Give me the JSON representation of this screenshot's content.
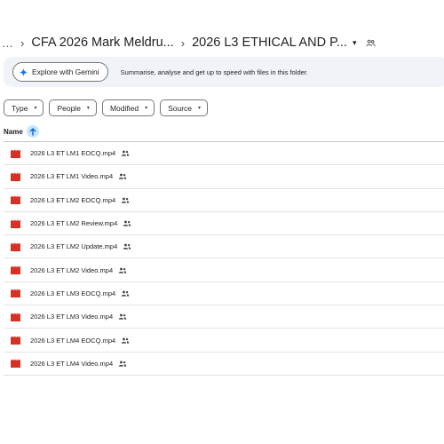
{
  "breadcrumb": {
    "more": "…",
    "separator": "›",
    "parent": "CFA 2026 Mark Meldru...",
    "current": "2026 L3 ETHICAL AND P...",
    "caret": "▾"
  },
  "gemini": {
    "button_label": "Explore with Gemini",
    "hint": "Summarise, analyse and get up to speed with files in this folder."
  },
  "filters": [
    {
      "label": "Type",
      "caret": "▾"
    },
    {
      "label": "People",
      "caret": "▾"
    },
    {
      "label": "Modified",
      "caret": "▾"
    },
    {
      "label": "Source",
      "caret": "▾"
    }
  ],
  "list_header": {
    "name_label": "Name",
    "sort_icon": "arrow-up-icon"
  },
  "files": [
    {
      "name": "2026 L3 ET LM1 EOCQ.mp4"
    },
    {
      "name": "2026 L3 ET LM1 Video.mp4"
    },
    {
      "name": "2026 L3 ET LM2 EOCQ.mp4"
    },
    {
      "name": "2026 L3 ET LM2 Review.mp4"
    },
    {
      "name": "2026 L3 ET LM2 Update.mp4"
    },
    {
      "name": "2026 L3 ET LM2 Video.mp4"
    },
    {
      "name": "2026 L3 ET LM3 EOCQ.mp4"
    },
    {
      "name": "2026 L3 ET LM3 Video.mp4"
    },
    {
      "name": "2026 L3 ET LM4 EOCQ.mp4"
    },
    {
      "name": "2026 L3 ET LM4 Video.mp4"
    }
  ],
  "colors": {
    "video_icon": "#d93025",
    "accent": "#0b57d0",
    "sort_bg": "#c2e7ff",
    "gemini_bar_bg": "#f0f4f9"
  }
}
